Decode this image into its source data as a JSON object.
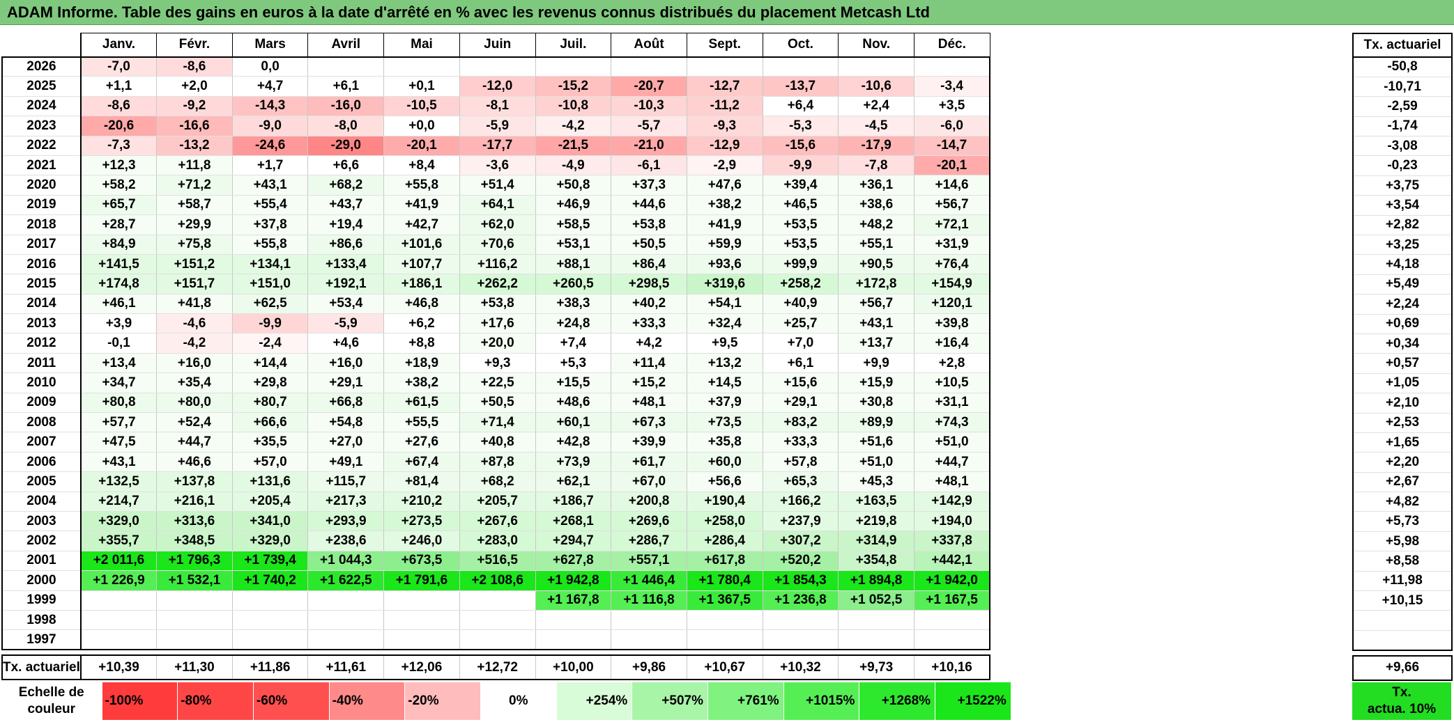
{
  "title": "ADAM Informe. Table des gains en euros à la date d'arrêté en % avec les revenus connus distribués du placement Metcash Ltd",
  "months": [
    "Janv.",
    "Févr.",
    "Mars",
    "Avril",
    "Mai",
    "Juin",
    "Juil.",
    "Août",
    "Sept.",
    "Oct.",
    "Nov.",
    "Déc."
  ],
  "side_header": "Tx. actuariel",
  "rows": [
    {
      "year": "2026",
      "values": [
        "-7,0",
        "-8,6",
        "0,0",
        "",
        "",
        "",
        "",
        "",
        "",
        "",
        "",
        ""
      ],
      "tx": "-50,8"
    },
    {
      "year": "2025",
      "values": [
        "+1,1",
        "+2,0",
        "+4,7",
        "+6,1",
        "+0,1",
        "-12,0",
        "-15,2",
        "-20,7",
        "-12,7",
        "-13,7",
        "-10,6",
        "-3,4"
      ],
      "tx": "-10,71"
    },
    {
      "year": "2024",
      "values": [
        "-8,6",
        "-9,2",
        "-14,3",
        "-16,0",
        "-10,5",
        "-8,1",
        "-10,8",
        "-10,3",
        "-11,2",
        "+6,4",
        "+2,4",
        "+3,5"
      ],
      "tx": "-2,59"
    },
    {
      "year": "2023",
      "values": [
        "-20,6",
        "-16,6",
        "-9,0",
        "-8,0",
        "+0,0",
        "-5,9",
        "-4,2",
        "-5,7",
        "-9,3",
        "-5,3",
        "-4,5",
        "-6,0"
      ],
      "tx": "-1,74"
    },
    {
      "year": "2022",
      "values": [
        "-7,3",
        "-13,2",
        "-24,6",
        "-29,0",
        "-20,1",
        "-17,7",
        "-21,5",
        "-21,0",
        "-12,9",
        "-15,6",
        "-17,9",
        "-14,7"
      ],
      "tx": "-3,08"
    },
    {
      "year": "2021",
      "values": [
        "+12,3",
        "+11,8",
        "+1,7",
        "+6,6",
        "+8,4",
        "-3,6",
        "-4,9",
        "-6,1",
        "-2,9",
        "-9,9",
        "-7,8",
        "-20,1"
      ],
      "tx": "-0,23"
    },
    {
      "year": "2020",
      "values": [
        "+58,2",
        "+71,2",
        "+43,1",
        "+68,2",
        "+55,8",
        "+51,4",
        "+50,8",
        "+37,3",
        "+47,6",
        "+39,4",
        "+36,1",
        "+14,6"
      ],
      "tx": "+3,75"
    },
    {
      "year": "2019",
      "values": [
        "+65,7",
        "+58,7",
        "+55,4",
        "+43,7",
        "+41,9",
        "+64,1",
        "+46,9",
        "+44,6",
        "+38,2",
        "+46,5",
        "+38,6",
        "+56,7"
      ],
      "tx": "+3,54"
    },
    {
      "year": "2018",
      "values": [
        "+28,7",
        "+29,9",
        "+37,8",
        "+19,4",
        "+42,7",
        "+62,0",
        "+58,5",
        "+53,8",
        "+41,9",
        "+53,5",
        "+48,2",
        "+72,1"
      ],
      "tx": "+2,82"
    },
    {
      "year": "2017",
      "values": [
        "+84,9",
        "+75,8",
        "+55,8",
        "+86,6",
        "+101,6",
        "+70,6",
        "+53,1",
        "+50,5",
        "+59,9",
        "+53,5",
        "+55,1",
        "+31,9"
      ],
      "tx": "+3,25"
    },
    {
      "year": "2016",
      "values": [
        "+141,5",
        "+151,2",
        "+134,1",
        "+133,4",
        "+107,7",
        "+116,2",
        "+88,1",
        "+86,4",
        "+93,6",
        "+99,9",
        "+90,5",
        "+76,4"
      ],
      "tx": "+4,18"
    },
    {
      "year": "2015",
      "values": [
        "+174,8",
        "+151,7",
        "+151,0",
        "+192,1",
        "+186,1",
        "+262,2",
        "+260,5",
        "+298,5",
        "+319,6",
        "+258,2",
        "+172,8",
        "+154,9"
      ],
      "tx": "+5,49"
    },
    {
      "year": "2014",
      "values": [
        "+46,1",
        "+41,8",
        "+62,5",
        "+53,4",
        "+46,8",
        "+53,8",
        "+38,3",
        "+40,2",
        "+54,1",
        "+40,9",
        "+56,7",
        "+120,1"
      ],
      "tx": "+2,24"
    },
    {
      "year": "2013",
      "values": [
        "+3,9",
        "-4,6",
        "-9,9",
        "-5,9",
        "+6,2",
        "+17,6",
        "+24,8",
        "+33,3",
        "+32,4",
        "+25,7",
        "+43,1",
        "+39,8"
      ],
      "tx": "+0,69"
    },
    {
      "year": "2012",
      "values": [
        "-0,1",
        "-4,2",
        "-2,4",
        "+4,6",
        "+8,8",
        "+20,0",
        "+7,4",
        "+4,2",
        "+9,5",
        "+7,0",
        "+13,7",
        "+16,4"
      ],
      "tx": "+0,34"
    },
    {
      "year": "2011",
      "values": [
        "+13,4",
        "+16,0",
        "+14,4",
        "+16,0",
        "+18,9",
        "+9,3",
        "+5,3",
        "+11,4",
        "+13,2",
        "+6,1",
        "+9,9",
        "+2,8"
      ],
      "tx": "+0,57"
    },
    {
      "year": "2010",
      "values": [
        "+34,7",
        "+35,4",
        "+29,8",
        "+29,1",
        "+38,2",
        "+22,5",
        "+15,5",
        "+15,2",
        "+14,5",
        "+15,6",
        "+15,9",
        "+10,5"
      ],
      "tx": "+1,05"
    },
    {
      "year": "2009",
      "values": [
        "+80,8",
        "+80,0",
        "+80,7",
        "+66,8",
        "+61,5",
        "+50,5",
        "+48,6",
        "+48,1",
        "+37,9",
        "+29,1",
        "+30,8",
        "+31,1"
      ],
      "tx": "+2,10"
    },
    {
      "year": "2008",
      "values": [
        "+57,7",
        "+52,4",
        "+66,6",
        "+54,8",
        "+55,5",
        "+71,4",
        "+60,1",
        "+67,3",
        "+73,5",
        "+83,2",
        "+89,9",
        "+74,3"
      ],
      "tx": "+2,53"
    },
    {
      "year": "2007",
      "values": [
        "+47,5",
        "+44,7",
        "+35,5",
        "+27,0",
        "+27,6",
        "+40,8",
        "+42,8",
        "+39,9",
        "+35,8",
        "+33,3",
        "+51,6",
        "+51,0"
      ],
      "tx": "+1,65"
    },
    {
      "year": "2006",
      "values": [
        "+43,1",
        "+46,6",
        "+57,0",
        "+49,1",
        "+67,4",
        "+87,8",
        "+73,9",
        "+61,7",
        "+60,0",
        "+57,8",
        "+51,0",
        "+44,7"
      ],
      "tx": "+2,20"
    },
    {
      "year": "2005",
      "values": [
        "+132,5",
        "+137,8",
        "+131,6",
        "+115,7",
        "+81,4",
        "+68,2",
        "+62,1",
        "+67,0",
        "+56,6",
        "+65,3",
        "+45,3",
        "+48,1"
      ],
      "tx": "+2,67"
    },
    {
      "year": "2004",
      "values": [
        "+214,7",
        "+216,1",
        "+205,4",
        "+217,3",
        "+210,2",
        "+205,7",
        "+186,7",
        "+200,8",
        "+190,4",
        "+166,2",
        "+163,5",
        "+142,9"
      ],
      "tx": "+4,82"
    },
    {
      "year": "2003",
      "values": [
        "+329,0",
        "+313,6",
        "+341,0",
        "+293,9",
        "+273,5",
        "+267,6",
        "+268,1",
        "+269,6",
        "+258,0",
        "+237,9",
        "+219,8",
        "+194,0"
      ],
      "tx": "+5,73"
    },
    {
      "year": "2002",
      "values": [
        "+355,7",
        "+348,5",
        "+329,0",
        "+238,6",
        "+246,0",
        "+283,0",
        "+294,7",
        "+286,7",
        "+286,4",
        "+307,2",
        "+314,9",
        "+337,8"
      ],
      "tx": "+5,98"
    },
    {
      "year": "2001",
      "values": [
        "+2 011,6",
        "+1 796,3",
        "+1 739,4",
        "+1 044,3",
        "+673,5",
        "+516,5",
        "+627,8",
        "+557,1",
        "+617,8",
        "+520,2",
        "+354,8",
        "+442,1"
      ],
      "tx": "+8,58"
    },
    {
      "year": "2000",
      "values": [
        "+1 226,9",
        "+1 532,1",
        "+1 740,2",
        "+1 622,5",
        "+1 791,6",
        "+2 108,6",
        "+1 942,8",
        "+1 446,4",
        "+1 780,4",
        "+1 854,3",
        "+1 894,8",
        "+1 942,0"
      ],
      "tx": "+11,98"
    },
    {
      "year": "1999",
      "values": [
        "",
        "",
        "",
        "",
        "",
        "",
        "+1 167,8",
        "+1 116,8",
        "+1 367,5",
        "+1 236,8",
        "+1 052,5",
        "+1 167,5"
      ],
      "tx": "+10,15"
    },
    {
      "year": "1998",
      "values": [
        "",
        "",
        "",
        "",
        "",
        "",
        "",
        "",
        "",
        "",
        "",
        ""
      ],
      "tx": ""
    },
    {
      "year": "1997",
      "values": [
        "",
        "",
        "",
        "",
        "",
        "",
        "",
        "",
        "",
        "",
        "",
        ""
      ],
      "tx": ""
    }
  ],
  "footer": {
    "label": "Tx. actuariel",
    "values": [
      "+10,39",
      "+11,30",
      "+11,86",
      "+11,61",
      "+12,06",
      "+12,72",
      "+10,00",
      "+9,86",
      "+10,67",
      "+10,32",
      "+9,73",
      "+10,16"
    ],
    "tx": "+9,66"
  },
  "legend": {
    "label_line1": "Echelle de",
    "label_line2": "couleur",
    "items": [
      {
        "text": "-100%",
        "color": "#ff3b3b",
        "align": "neg"
      },
      {
        "text": "-80%",
        "color": "#ff4646",
        "align": "neg"
      },
      {
        "text": "-60%",
        "color": "#ff5050",
        "align": "neg"
      },
      {
        "text": "-40%",
        "color": "#ff8a8a",
        "align": "neg"
      },
      {
        "text": "-20%",
        "color": "#ffbcbc",
        "align": "neg"
      },
      {
        "text": "0%",
        "color": "#ffffff",
        "align": "zero"
      },
      {
        "text": "+254%",
        "color": "#d8fcd8",
        "align": "pos"
      },
      {
        "text": "+507%",
        "color": "#a8f5a8",
        "align": "pos"
      },
      {
        "text": "+761%",
        "color": "#7ff27f",
        "align": "pos"
      },
      {
        "text": "+1015%",
        "color": "#55ee55",
        "align": "pos"
      },
      {
        "text": "+1268%",
        "color": "#2ee82e",
        "align": "pos"
      },
      {
        "text": "+1522%",
        "color": "#1ae61a",
        "align": "pos"
      }
    ],
    "actua_line1": "Tx.",
    "actua_line2": "actua. 10%"
  }
}
